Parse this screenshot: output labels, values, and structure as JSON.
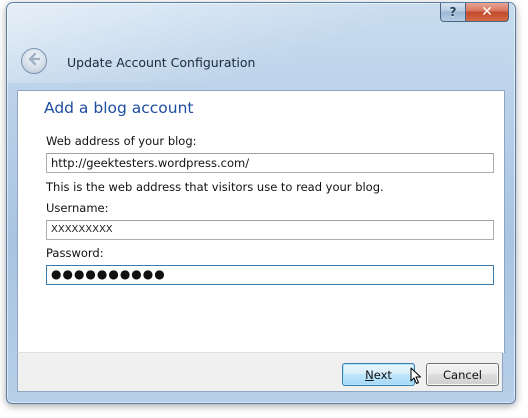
{
  "window": {
    "title": "Update Account Configuration",
    "help_label": "?",
    "close_label": "✕"
  },
  "form": {
    "heading": "Add a blog account",
    "web_address": {
      "label": "Web address of your blog:",
      "value": "http://geektesters.wordpress.com/",
      "hint": "This is the web address that visitors use to read your blog."
    },
    "username": {
      "label": "Username:",
      "value": "XXXXXXXXX"
    },
    "password": {
      "label": "Password:",
      "value": "●●●●●●●●●●"
    }
  },
  "footer": {
    "next_first": "N",
    "next_rest": "ext",
    "cancel_label": "Cancel"
  },
  "icons": {
    "back": "back-arrow-icon",
    "cursor": "mouse-pointer-icon"
  },
  "colors": {
    "heading": "#1e4ea0",
    "close": "#c24a2a",
    "focus": "#3d7bad"
  }
}
